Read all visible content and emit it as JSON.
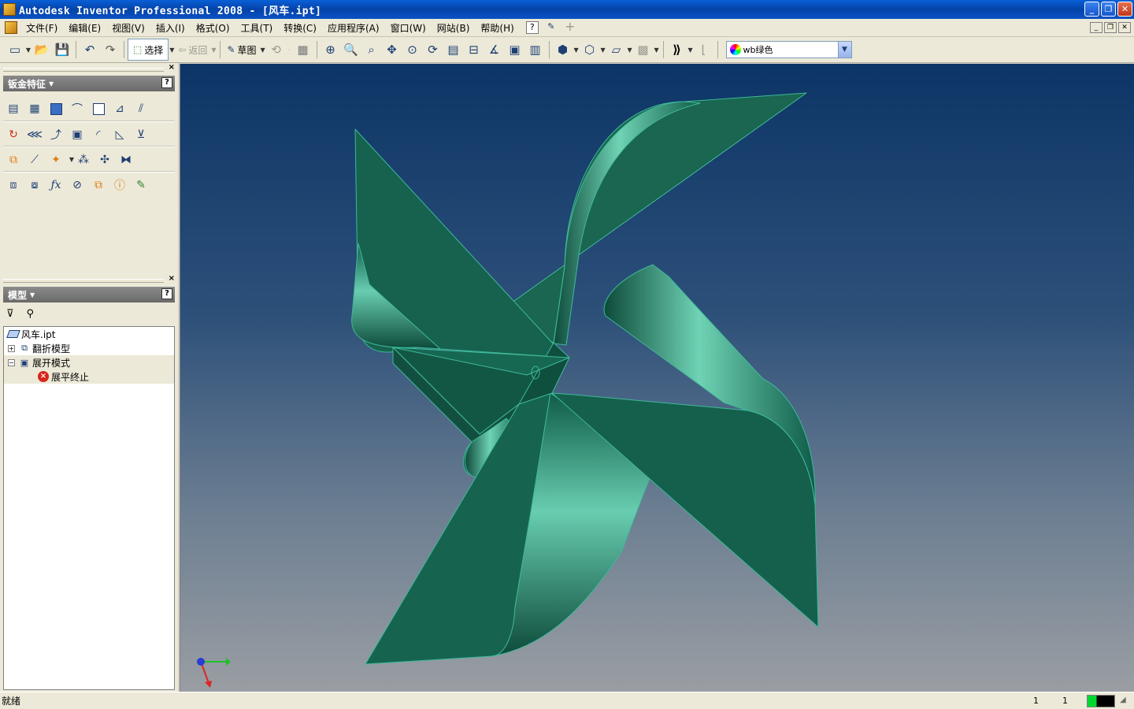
{
  "window": {
    "title": "Autodesk Inventor Professional 2008 - [风车.ipt]",
    "controls": [
      "_",
      "❐",
      "✕"
    ]
  },
  "menubar": {
    "items": [
      "文件(F)",
      "编辑(E)",
      "视图(V)",
      "插入(I)",
      "格式(O)",
      "工具(T)",
      "转换(C)",
      "应用程序(A)",
      "窗口(W)",
      "网站(B)",
      "帮助(H)"
    ]
  },
  "toolbar": {
    "select_label": "选择",
    "back_label": "返回",
    "sketch_label": "草图",
    "color_value": "wb绿色"
  },
  "sheetmetal_panel": {
    "title": "钣金特征"
  },
  "model_panel": {
    "title": "模型",
    "tree": [
      {
        "label": "风车.ipt",
        "icon": "part-icon"
      },
      {
        "label": "翻折模型",
        "icon": "folded-model-icon"
      },
      {
        "label": "展开模式",
        "icon": "flat-pattern-icon"
      },
      {
        "label": "展平终止",
        "icon": "error-icon"
      }
    ]
  },
  "statusbar": {
    "text": "就绪",
    "num1": "1",
    "num2": "1"
  },
  "colors": {
    "part_green": "#16624e",
    "part_edge": "#3fb89a",
    "viewport_top": "#0c3566",
    "viewport_bottom": "#9a9ea3"
  }
}
